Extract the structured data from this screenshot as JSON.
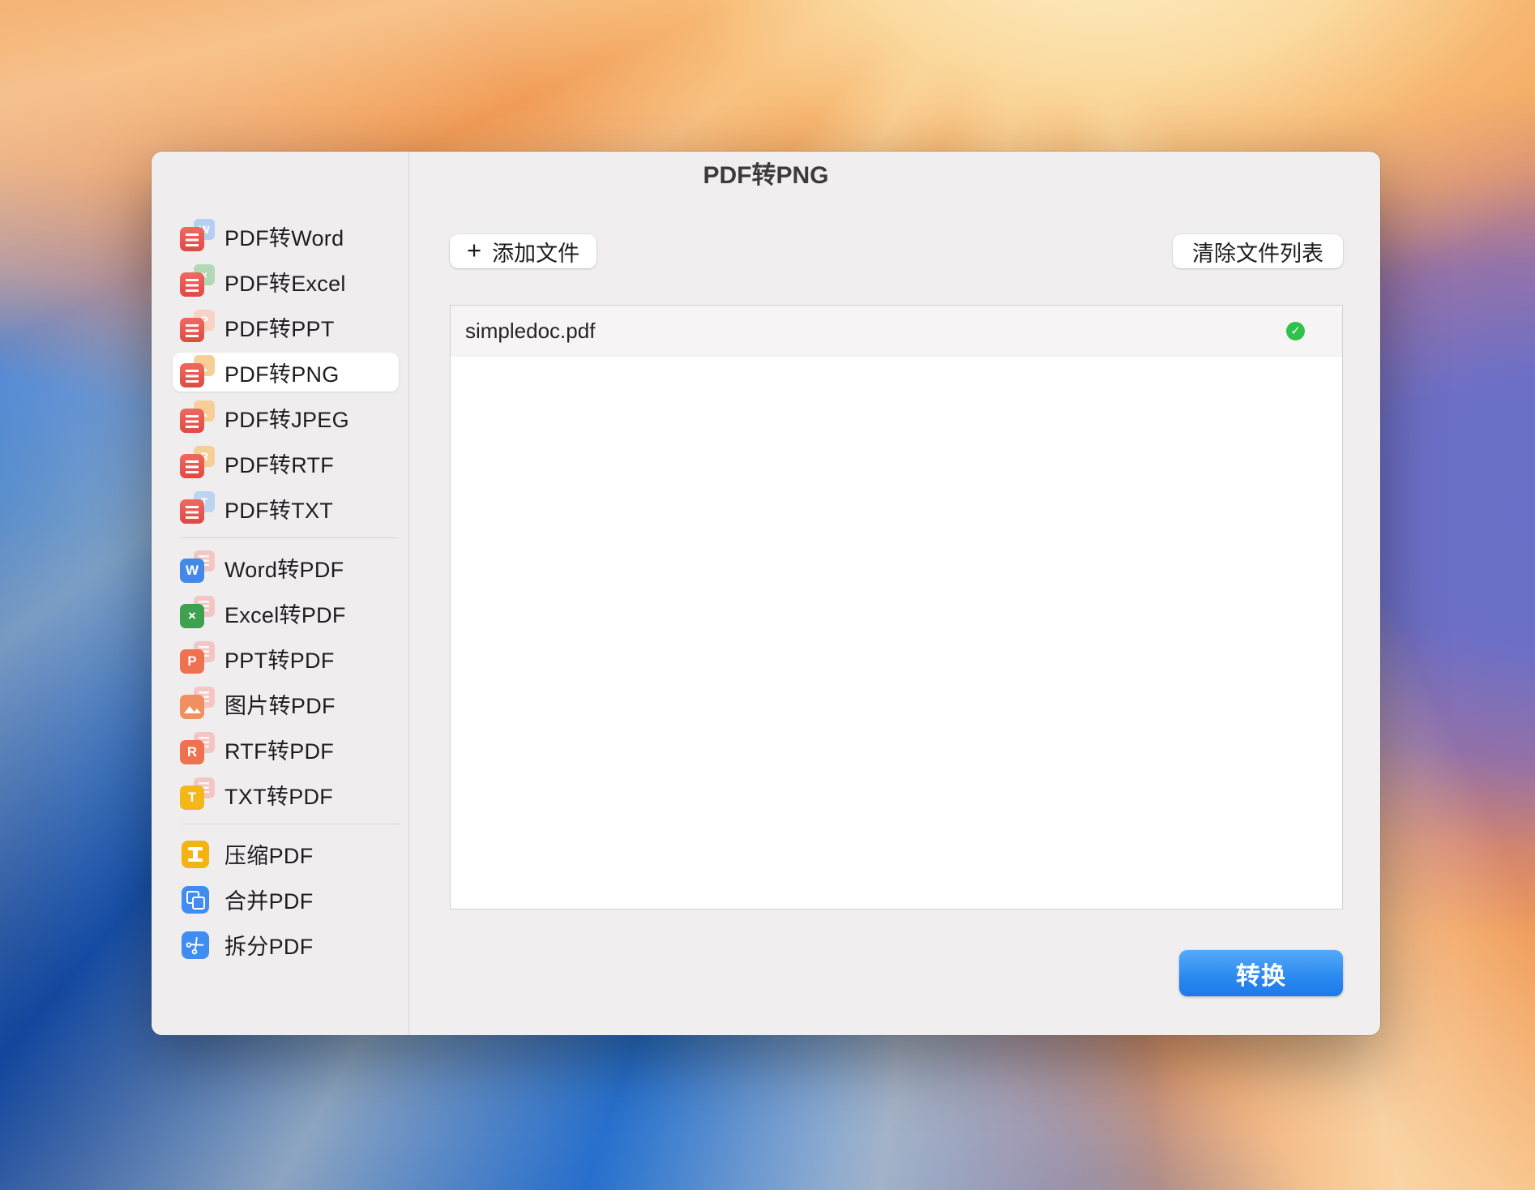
{
  "window": {
    "title": "PDF转PNG"
  },
  "sidebar": {
    "items": [
      {
        "label": "PDF转Word",
        "selected": false
      },
      {
        "label": "PDF转Excel",
        "selected": false
      },
      {
        "label": "PDF转PPT",
        "selected": false
      },
      {
        "label": "PDF转PNG",
        "selected": true
      },
      {
        "label": "PDF转JPEG",
        "selected": false
      },
      {
        "label": "PDF转RTF",
        "selected": false
      },
      {
        "label": "PDF转TXT",
        "selected": false
      },
      {
        "label": "Word转PDF",
        "selected": false
      },
      {
        "label": "Excel转PDF",
        "selected": false
      },
      {
        "label": "PPT转PDF",
        "selected": false
      },
      {
        "label": "图片转PDF",
        "selected": false
      },
      {
        "label": "RTF转PDF",
        "selected": false
      },
      {
        "label": "TXT转PDF",
        "selected": false
      },
      {
        "label": "压缩PDF",
        "selected": false
      },
      {
        "label": "合并PDF",
        "selected": false
      },
      {
        "label": "拆分PDF",
        "selected": false
      }
    ]
  },
  "toolbar": {
    "add_file_label": "添加文件",
    "add_file_plus": "+",
    "clear_list_label": "清除文件列表"
  },
  "file_list": {
    "files": [
      {
        "name": "simpledoc.pdf",
        "status": "success",
        "status_icon": "check-circle",
        "check_glyph": "✓"
      }
    ]
  },
  "footer": {
    "convert_label": "转换"
  },
  "colors": {
    "accent_blue": "#2a88f0",
    "success_green": "#30c14c",
    "pdf_red": "#e4544c",
    "traffic_close": "#f4554d",
    "traffic_minimize": "#f6bd3f",
    "traffic_zoom": "#2fc748"
  }
}
